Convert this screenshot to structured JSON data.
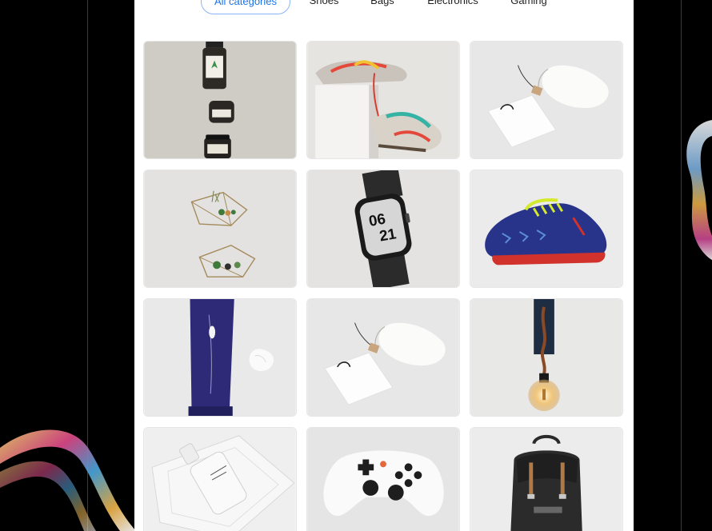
{
  "filters": {
    "all": "All categories",
    "shoes": "Shoes",
    "bags": "Bags",
    "electronics": "Electronics",
    "gaming": "Gaming"
  },
  "products": {
    "watch_date": {
      "line1": "06",
      "line2": "21"
    }
  },
  "colors": {
    "accent": "#1a73e8",
    "chip_border": "#8ab4f8",
    "page_background": "#000000",
    "panel_background": "#ffffff"
  }
}
